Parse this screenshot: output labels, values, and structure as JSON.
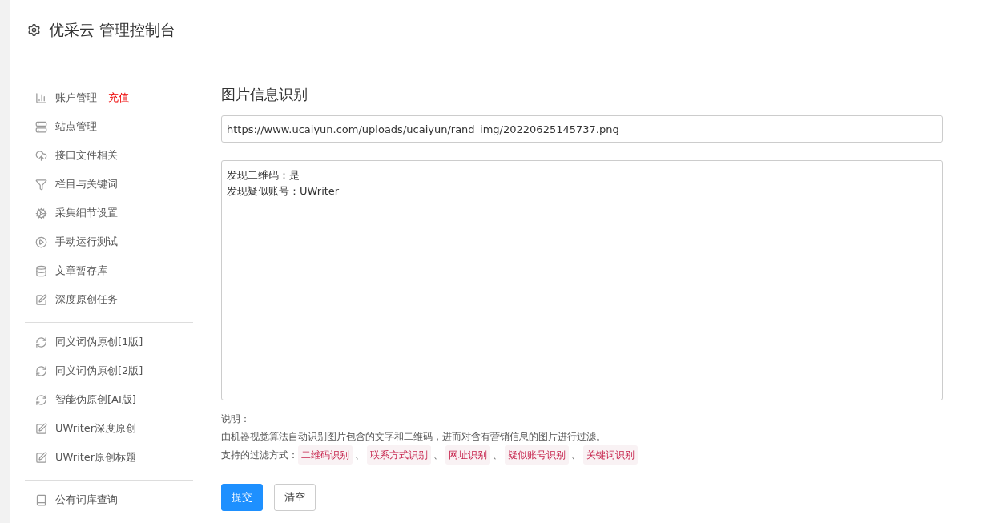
{
  "header": {
    "title": "优采云 管理控制台"
  },
  "sidebar": {
    "groups": [
      [
        {
          "label": "账户管理",
          "badge": "充值"
        },
        {
          "label": "站点管理"
        },
        {
          "label": "接口文件相关"
        },
        {
          "label": "栏目与关键词"
        },
        {
          "label": "采集细节设置"
        },
        {
          "label": "手动运行测试"
        },
        {
          "label": "文章暂存库"
        },
        {
          "label": "深度原创任务"
        }
      ],
      [
        {
          "label": "同义词伪原创[1版]"
        },
        {
          "label": "同义词伪原创[2版]"
        },
        {
          "label": "智能伪原创[AI版]"
        },
        {
          "label": "UWriter深度原创"
        },
        {
          "label": "UWriter原创标题"
        }
      ],
      [
        {
          "label": "公有词库查询"
        }
      ]
    ]
  },
  "main": {
    "title": "图片信息识别",
    "url_field": {
      "value": "https://www.ucaiyun.com/uploads/ucaiyun/rand_img/20220625145737.png"
    },
    "result_lines": [
      "发现二维码：是",
      "发现疑似账号：UWriter"
    ],
    "note_label": "说明：",
    "note_text": "由机器视觉算法自动识别图片包含的文字和二维码，进而对含有营销信息的图片进行过滤。",
    "filters_label": "支持的过滤方式：",
    "separator": "、",
    "filters": [
      "二维码识别",
      "联系方式识别",
      "网址识别",
      "疑似账号识别",
      "关键词识别"
    ],
    "buttons": [
      {
        "label": "提交",
        "kind": "primary"
      },
      {
        "label": "清空",
        "kind": "default"
      }
    ]
  }
}
